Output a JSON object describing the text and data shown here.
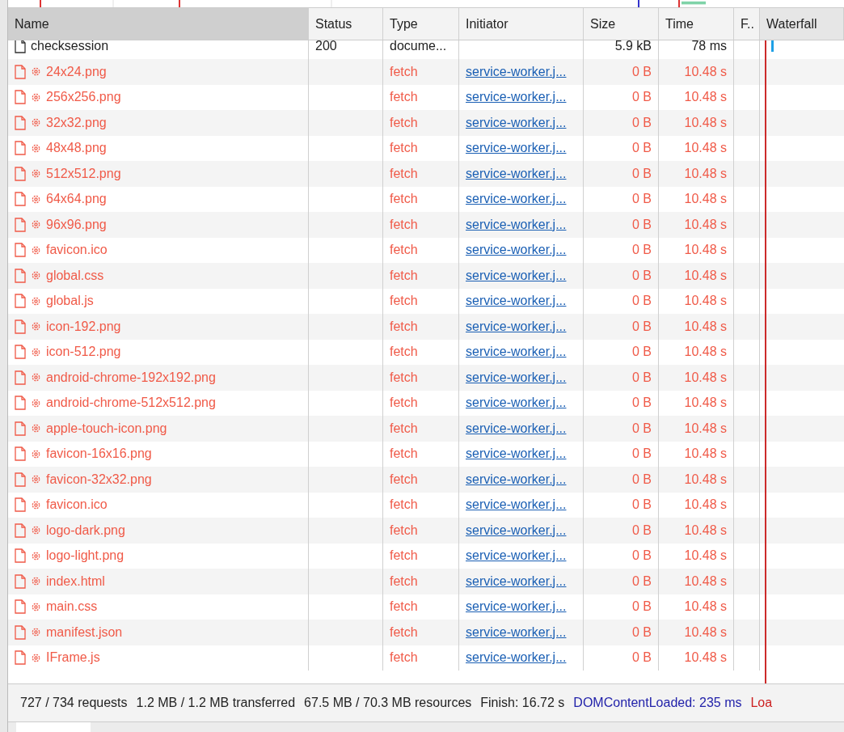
{
  "table": {
    "columns": [
      {
        "label": "Name",
        "sorted": true
      },
      {
        "label": "Status",
        "sorted": false
      },
      {
        "label": "Type",
        "sorted": false
      },
      {
        "label": "Initiator",
        "sorted": false
      },
      {
        "label": "Size",
        "sorted": false
      },
      {
        "label": "Time",
        "sorted": false
      },
      {
        "label": "F..",
        "sorted": false
      },
      {
        "label": "Waterfall",
        "sorted": false
      }
    ],
    "rows": [
      {
        "name": "checksession",
        "failed": false,
        "service_worker": false,
        "status": "200",
        "type": "docume...",
        "initiator": "",
        "size": "5.9 kB",
        "time": "78 ms"
      },
      {
        "name": "24x24.png",
        "failed": true,
        "service_worker": true,
        "status": "",
        "type": "fetch",
        "initiator": "service-worker.j...",
        "size": "0 B",
        "time": "10.48 s"
      },
      {
        "name": "256x256.png",
        "failed": true,
        "service_worker": true,
        "status": "",
        "type": "fetch",
        "initiator": "service-worker.j...",
        "size": "0 B",
        "time": "10.48 s"
      },
      {
        "name": "32x32.png",
        "failed": true,
        "service_worker": true,
        "status": "",
        "type": "fetch",
        "initiator": "service-worker.j...",
        "size": "0 B",
        "time": "10.48 s"
      },
      {
        "name": "48x48.png",
        "failed": true,
        "service_worker": true,
        "status": "",
        "type": "fetch",
        "initiator": "service-worker.j...",
        "size": "0 B",
        "time": "10.48 s"
      },
      {
        "name": "512x512.png",
        "failed": true,
        "service_worker": true,
        "status": "",
        "type": "fetch",
        "initiator": "service-worker.j...",
        "size": "0 B",
        "time": "10.48 s"
      },
      {
        "name": "64x64.png",
        "failed": true,
        "service_worker": true,
        "status": "",
        "type": "fetch",
        "initiator": "service-worker.j...",
        "size": "0 B",
        "time": "10.48 s"
      },
      {
        "name": "96x96.png",
        "failed": true,
        "service_worker": true,
        "status": "",
        "type": "fetch",
        "initiator": "service-worker.j...",
        "size": "0 B",
        "time": "10.48 s"
      },
      {
        "name": "favicon.ico",
        "failed": true,
        "service_worker": true,
        "status": "",
        "type": "fetch",
        "initiator": "service-worker.j...",
        "size": "0 B",
        "time": "10.48 s"
      },
      {
        "name": "global.css",
        "failed": true,
        "service_worker": true,
        "status": "",
        "type": "fetch",
        "initiator": "service-worker.j...",
        "size": "0 B",
        "time": "10.48 s"
      },
      {
        "name": "global.js",
        "failed": true,
        "service_worker": true,
        "status": "",
        "type": "fetch",
        "initiator": "service-worker.j...",
        "size": "0 B",
        "time": "10.48 s"
      },
      {
        "name": "icon-192.png",
        "failed": true,
        "service_worker": true,
        "status": "",
        "type": "fetch",
        "initiator": "service-worker.j...",
        "size": "0 B",
        "time": "10.48 s"
      },
      {
        "name": "icon-512.png",
        "failed": true,
        "service_worker": true,
        "status": "",
        "type": "fetch",
        "initiator": "service-worker.j...",
        "size": "0 B",
        "time": "10.48 s"
      },
      {
        "name": "android-chrome-192x192.png",
        "failed": true,
        "service_worker": true,
        "status": "",
        "type": "fetch",
        "initiator": "service-worker.j...",
        "size": "0 B",
        "time": "10.48 s"
      },
      {
        "name": "android-chrome-512x512.png",
        "failed": true,
        "service_worker": true,
        "status": "",
        "type": "fetch",
        "initiator": "service-worker.j...",
        "size": "0 B",
        "time": "10.48 s"
      },
      {
        "name": "apple-touch-icon.png",
        "failed": true,
        "service_worker": true,
        "status": "",
        "type": "fetch",
        "initiator": "service-worker.j...",
        "size": "0 B",
        "time": "10.48 s"
      },
      {
        "name": "favicon-16x16.png",
        "failed": true,
        "service_worker": true,
        "status": "",
        "type": "fetch",
        "initiator": "service-worker.j...",
        "size": "0 B",
        "time": "10.48 s"
      },
      {
        "name": "favicon-32x32.png",
        "failed": true,
        "service_worker": true,
        "status": "",
        "type": "fetch",
        "initiator": "service-worker.j...",
        "size": "0 B",
        "time": "10.48 s"
      },
      {
        "name": "favicon.ico",
        "failed": true,
        "service_worker": true,
        "status": "",
        "type": "fetch",
        "initiator": "service-worker.j...",
        "size": "0 B",
        "time": "10.48 s"
      },
      {
        "name": "logo-dark.png",
        "failed": true,
        "service_worker": true,
        "status": "",
        "type": "fetch",
        "initiator": "service-worker.j...",
        "size": "0 B",
        "time": "10.48 s"
      },
      {
        "name": "logo-light.png",
        "failed": true,
        "service_worker": true,
        "status": "",
        "type": "fetch",
        "initiator": "service-worker.j...",
        "size": "0 B",
        "time": "10.48 s"
      },
      {
        "name": "index.html",
        "failed": true,
        "service_worker": true,
        "status": "",
        "type": "fetch",
        "initiator": "service-worker.j...",
        "size": "0 B",
        "time": "10.48 s"
      },
      {
        "name": "main.css",
        "failed": true,
        "service_worker": true,
        "status": "",
        "type": "fetch",
        "initiator": "service-worker.j...",
        "size": "0 B",
        "time": "10.48 s"
      },
      {
        "name": "manifest.json",
        "failed": true,
        "service_worker": true,
        "status": "",
        "type": "fetch",
        "initiator": "service-worker.j...",
        "size": "0 B",
        "time": "10.48 s"
      },
      {
        "name": "IFrame.js",
        "failed": true,
        "service_worker": true,
        "status": "",
        "type": "fetch",
        "initiator": "service-worker.j...",
        "size": "0 B",
        "time": "10.48 s"
      }
    ]
  },
  "status_bar": [
    {
      "text": "727 / 734 requests",
      "kind": "plain"
    },
    {
      "text": "1.2 MB / 1.2 MB transferred",
      "kind": "plain"
    },
    {
      "text": "67.5 MB / 70.3 MB resources",
      "kind": "plain"
    },
    {
      "text": "Finish: 16.72 s",
      "kind": "plain"
    },
    {
      "text": "DOMContentLoaded: 235 ms",
      "kind": "dcl"
    },
    {
      "text": "Loa",
      "kind": "load"
    }
  ]
}
